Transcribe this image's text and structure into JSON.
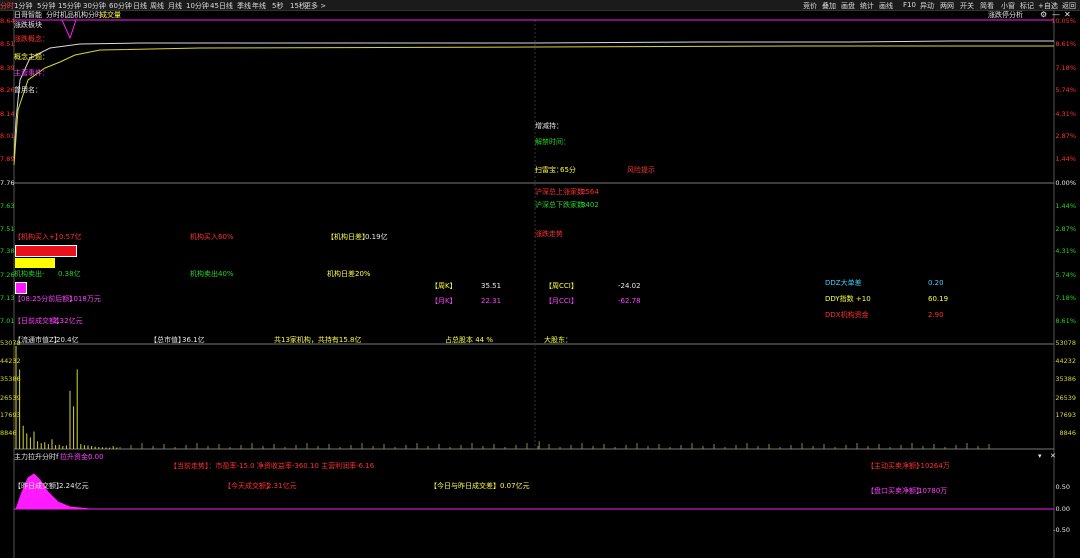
{
  "toolbar": {
    "items": [
      "分时",
      "1分钟",
      "5分钟",
      "15分钟",
      "30分钟",
      "60分钟",
      "日线",
      "周线",
      "月线",
      "10分钟",
      "45日线",
      "季线",
      "年线",
      "5秒",
      "15秒",
      "更多 >"
    ],
    "right_items": [
      "竞价",
      "叠加",
      "画盘",
      "统计",
      "画线",
      "F10",
      "异动",
      "两网",
      "开关",
      "简看",
      "小窗",
      "标记",
      "+自选",
      "返回"
    ]
  },
  "header": {
    "stock_name": "日哥智能",
    "mode_label": "分时",
    "indicator_title": "机品机构分时",
    "volume_label": "成交量",
    "analysis_link": "涨跌停分析"
  },
  "main_left": {
    "l1": "涨跌板块",
    "l2": "涨跌概念：",
    "l3": "概念主题：",
    "l4": "主营事件：",
    "l5": "曾用名："
  },
  "main_right": {
    "r1": "增减持：",
    "r2": "解禁时间：",
    "r3": "扫雷宝：",
    "r3_value": "65分",
    "r3_note": "风险提示",
    "r4": "沪深总上涨家数:",
    "r4_value": "2564",
    "r5": "沪深总下跌家数:",
    "r5_value": "3402",
    "r6": "涨跌走势"
  },
  "price_axis_left": [
    "8.64",
    "8.51",
    "8.39",
    "8.26",
    "8.14",
    "8.01",
    "7.89",
    "7.76",
    "7.63",
    "7.51",
    "7.38",
    "7.26",
    "7.13",
    "7.01"
  ],
  "pct_axis_right": [
    "10.05%",
    "8.61%",
    "7.18%",
    "5.74%",
    "4.31%",
    "2.87%",
    "1.44%",
    "0.00%",
    "1.44%",
    "2.87%",
    "4.31%",
    "5.74%",
    "7.18%",
    "8.61%"
  ],
  "institution": {
    "buy_label": "【机构买入+】",
    "buy_value": "0.57亿",
    "buy_pct": "机构买入60%",
    "margin_label": "【机构日差】",
    "margin_value": "0.19亿",
    "sell_label": "机构卖出-",
    "sell_value": "0.38亿",
    "sell_pct": "机构卖出40%",
    "daily_label": "机构日差20%",
    "ratio_label": "【08:25分前后额】",
    "ratio_value": "1018万元",
    "today_label": "【日前成交额】",
    "today_value": "2.32亿元"
  },
  "indicators": {
    "k_label": "【周K】",
    "k_value": "35.51",
    "cci_label": "【周CCI】",
    "cci_value": "-24.02",
    "k2_label": "【月K】",
    "k2_value": "22.31",
    "cci2_label": "【月CCI】",
    "cci2_value": "-62.78"
  },
  "ddz": {
    "l1": "DDZ大单差",
    "v1": "0.20",
    "l2": "DDY指数 +10",
    "v2": "60.19",
    "l3": "DDX机构资金",
    "v3": "2.90"
  },
  "volume_bar": {
    "circ_label": "【流通市值Z】",
    "circ_value": "20.4亿",
    "total_label": "【总市值】",
    "total_value": "36.1亿",
    "inst_text": "共13家机构，共持有15.8亿",
    "pct_text": "占总股本 44 %",
    "holder_text": "大股东："
  },
  "volume_axis_left": [
    "53078",
    "44232",
    "35386",
    "26539",
    "17693",
    "8846"
  ],
  "volume_axis_right": [
    "53078",
    "44232",
    "35386",
    "26539",
    "17693",
    "8846"
  ],
  "volume_values": [
    53078,
    41000,
    12000,
    8000,
    6000,
    9000,
    4000,
    3000,
    3500,
    2500,
    5000,
    2000,
    2200,
    1500,
    1800,
    30000,
    22000,
    41000,
    2500,
    2000,
    1800,
    1500,
    1200,
    1000,
    900,
    800,
    700,
    1500,
    800
  ],
  "volume_late": [
    {
      "x": 0.505,
      "v": 4000
    }
  ],
  "flow": {
    "title": "主力拉升分时f",
    "sub_label": "拉升资金：",
    "sub_value": "0.00",
    "info_line": "【当前走势】：市盈率-15.0 净资收益率-360.10 主营利润率-6.16",
    "buy_label": "【主动买卖净额】",
    "buy_value": "-10264万",
    "today_label": "【昨日成交额】",
    "today_value": "2.24亿元",
    "now_label": "【今天成交额】",
    "now_value": "2.31亿元",
    "diff_text": "【今日与昨日成交差】0.07亿元",
    "total_label": "【盘口买卖净额】",
    "total_value": "10780万",
    "axis_right": [
      "0.50",
      "0.00",
      "-0.50"
    ]
  },
  "colors": {
    "bg": "#000000",
    "red": "#ff3030",
    "green": "#25d425",
    "magenta": "#ff1aff",
    "yellow": "#ffff40",
    "price_line": "#d9d9d9",
    "avg_line": "#d6d630"
  }
}
